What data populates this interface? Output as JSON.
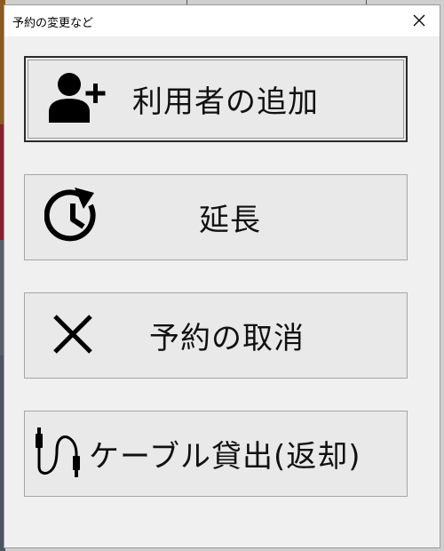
{
  "window": {
    "title": "予約の変更など"
  },
  "buttons": {
    "add_user": {
      "label": "利用者の追加",
      "icon": "user-plus-icon"
    },
    "extend": {
      "label": "延長",
      "icon": "clock-history-icon"
    },
    "cancel": {
      "label": "予約の取消",
      "icon": "x-icon"
    },
    "cable": {
      "label": "ケーブル貸出(返却)",
      "icon": "usb-cable-icon"
    }
  }
}
